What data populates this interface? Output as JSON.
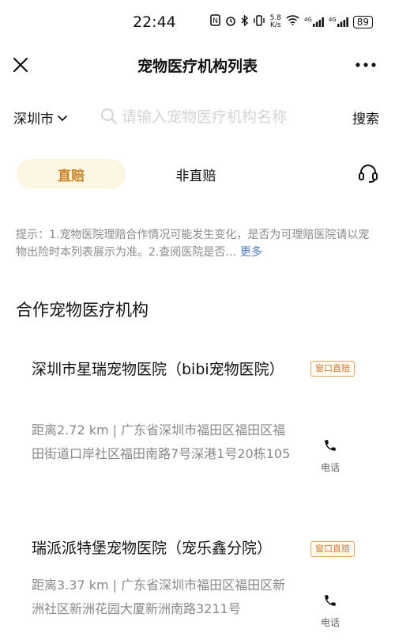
{
  "status_bar": {
    "time": "22:44",
    "speed_value": "5.8",
    "speed_unit": "K/s",
    "network_1": "4G",
    "network_2": "4G",
    "battery": "89"
  },
  "header": {
    "title": "宠物医疗机构列表"
  },
  "search": {
    "city": "深圳市",
    "placeholder": "请输入宠物医疗机构名称",
    "button_label": "搜索"
  },
  "tabs": [
    {
      "label": "直赔",
      "active": true
    },
    {
      "label": "非直赔",
      "active": false
    }
  ],
  "notice": {
    "text": "提示：1.宠物医院理赔合作情况可能发生变化，是否为可理赔医院请以宠物出险时本列表展示为准。2.查阅医院是否…",
    "more_label": "更多"
  },
  "section_title": "合作宠物医疗机构",
  "clinics": [
    {
      "name": "深圳市星瑞宠物医院（bibi宠物医院）",
      "badge": "窗口直赔",
      "address": "距离2.72 km | 广东省深圳市福田区福田区福田街道口岸社区福田南路7号深港1号20栋105",
      "phone_label": "电话"
    },
    {
      "name": "瑞派派特堡宠物医院（宠乐鑫分院）",
      "badge": "窗口直赔",
      "address": "距离3.37 km | 广东省深圳市福田区福田区新洲社区新洲花园大厦新洲南路3211号",
      "phone_label": "电话"
    }
  ],
  "colors": {
    "accent": "#c9862a",
    "tab_active_bg": "#fdf6e3",
    "badge_border": "#e8a25a",
    "link": "#4a78c8",
    "muted_text": "#888888"
  },
  "icons": {
    "close": "close-icon",
    "more": "more-icon",
    "dropdown": "chevron-down-icon",
    "search": "search-icon",
    "service": "headset-icon",
    "phone": "phone-icon"
  }
}
